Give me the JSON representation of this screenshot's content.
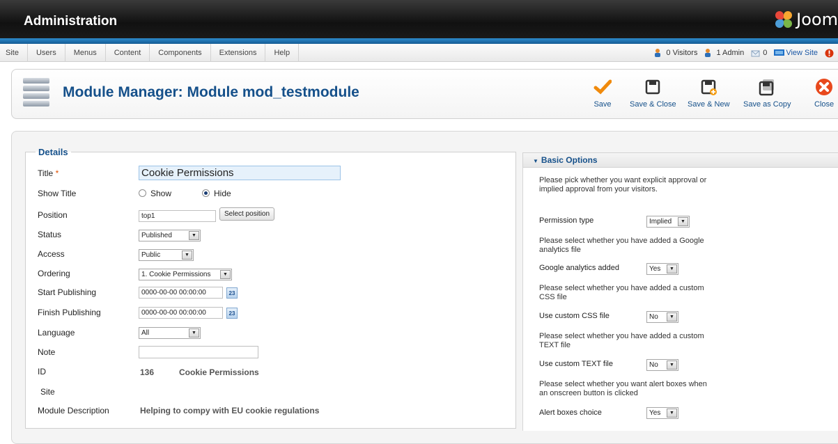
{
  "header": {
    "title": "Administration",
    "logo_text": "Joom"
  },
  "menu": {
    "items": [
      "Site",
      "Users",
      "Menus",
      "Content",
      "Components",
      "Extensions",
      "Help"
    ]
  },
  "status": {
    "visitors": "0 Visitors",
    "admins": "1 Admin",
    "messages": "0",
    "view_site": "View Site"
  },
  "toolbar": {
    "page_title": "Module Manager: Module mod_testmodule",
    "save": "Save",
    "save_close": "Save & Close",
    "save_new": "Save & New",
    "save_copy": "Save as Copy",
    "close": "Close"
  },
  "details": {
    "legend": "Details",
    "title_label": "Title",
    "title_required_mark": "*",
    "title_value": "Cookie Permissions",
    "show_title_label": "Show Title",
    "show_option": "Show",
    "hide_option": "Hide",
    "position_label": "Position",
    "position_value": "top1",
    "select_position": "Select position",
    "status_label": "Status",
    "status_value": "Published",
    "access_label": "Access",
    "access_value": "Public",
    "ordering_label": "Ordering",
    "ordering_value": "1. Cookie Permissions",
    "start_label": "Start Publishing",
    "start_value": "0000-00-00 00:00:00",
    "finish_label": "Finish Publishing",
    "finish_value": "0000-00-00 00:00:00",
    "calendar_text": "23",
    "language_label": "Language",
    "language_value": "All",
    "note_label": "Note",
    "note_value": "",
    "id_label": "ID",
    "id_value": "136",
    "id_name": "Cookie Permissions",
    "site_label": "Site",
    "desc_label": "Module Description",
    "desc_value": "Helping to compy with EU cookie regulations"
  },
  "options": {
    "header": "Basic Options",
    "desc1": "Please pick whether you want explicit approval or implied approval from your visitors.",
    "perm_label": "Permission type",
    "perm_value": "Implied",
    "desc2": "Please select whether you have added a Google analytics file",
    "ga_label": "Google analytics added",
    "ga_value": "Yes",
    "desc3": "Please select whether you have added a custom CSS file",
    "css_label": "Use custom CSS file",
    "css_value": "No",
    "desc4": "Please select whether you have added a custom TEXT file",
    "text_label": "Use custom TEXT file",
    "text_value": "No",
    "desc5": "Please select whether you want alert boxes when an onscreen button is clicked",
    "alert_label": "Alert boxes choice",
    "alert_value": "Yes"
  }
}
